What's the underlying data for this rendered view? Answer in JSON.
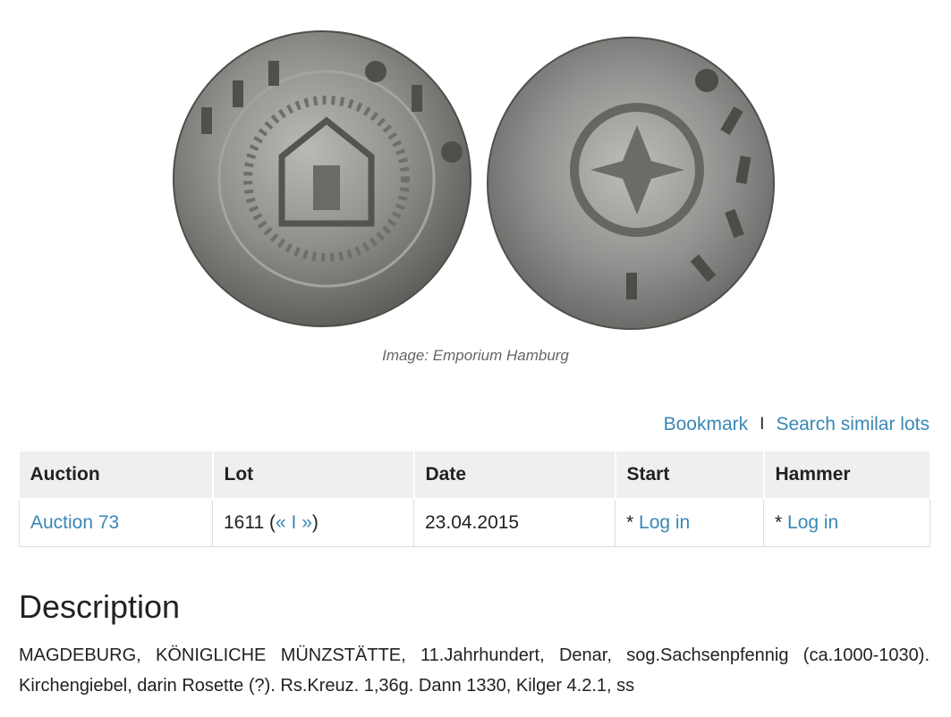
{
  "image": {
    "caption": "Image: Emporium Hamburg"
  },
  "actions": {
    "bookmark_label": "Bookmark",
    "separator": "I",
    "search_label": "Search similar lots"
  },
  "table": {
    "headers": [
      "Auction",
      "Lot",
      "Date",
      "Start",
      "Hammer"
    ],
    "row": {
      "auction": "Auction 73",
      "lot_number": "1611",
      "lot_open": " (",
      "prev": "«",
      "lot_sep": " I ",
      "next": "»",
      "lot_close": ")",
      "date": "23.04.2015",
      "start_prefix": "* ",
      "start_link": "Log in",
      "hammer_prefix": "* ",
      "hammer_link": "Log in"
    }
  },
  "description": {
    "title": "Description",
    "text": "MAGDEBURG, KÖNIGLICHE MÜNZSTÄTTE, 11.Jahrhundert, Denar, sog.Sachsenpfennig (ca.1000-1030). Kirchengiebel, darin Rosette (?). Rs.Kreuz. 1,36g. Dann 1330, Kilger 4.2.1, ss"
  },
  "colors": {
    "link": "#3a87b5",
    "header_bg": "#efefef"
  }
}
